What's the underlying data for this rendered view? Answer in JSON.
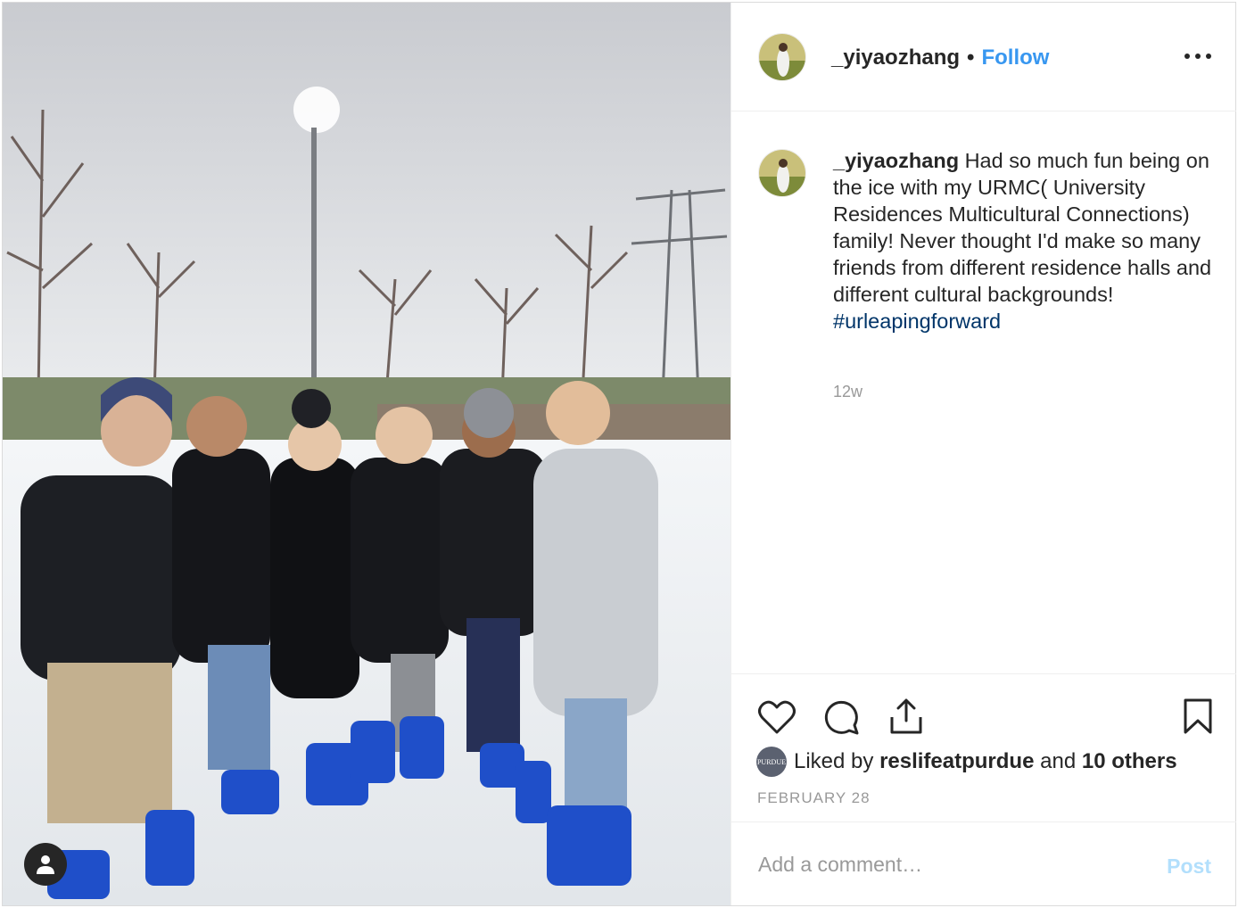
{
  "post": {
    "author": "_yiyaozhang",
    "header_separator": "•",
    "follow_label": "Follow",
    "caption": {
      "username": "_yiyaozhang",
      "text": "Had so much fun being on the ice with my URMC( University Residences Multicultural Connections) family! Never thought I'd make so many friends from different residence halls and different cultural backgrounds!",
      "hashtag": "#urleapingforward",
      "age": "12w"
    },
    "likes": {
      "prefix": "Liked by",
      "liker": "reslifeatpurdue",
      "middle": "and",
      "others": "10 others",
      "liker_avatar_text": "PURDUE"
    },
    "date": "FEBRUARY 28",
    "comment": {
      "placeholder": "Add a comment…",
      "post_label": "Post"
    }
  },
  "icons": {
    "more": "more-options-icon",
    "like": "heart-icon",
    "comment": "comment-icon",
    "share": "share-icon",
    "save": "bookmark-icon",
    "tagged": "user-tag-icon"
  },
  "colors": {
    "follow": "#3897f0",
    "hashtag": "#003569",
    "muted": "#999999",
    "post_disabled": "#b2dffc"
  }
}
